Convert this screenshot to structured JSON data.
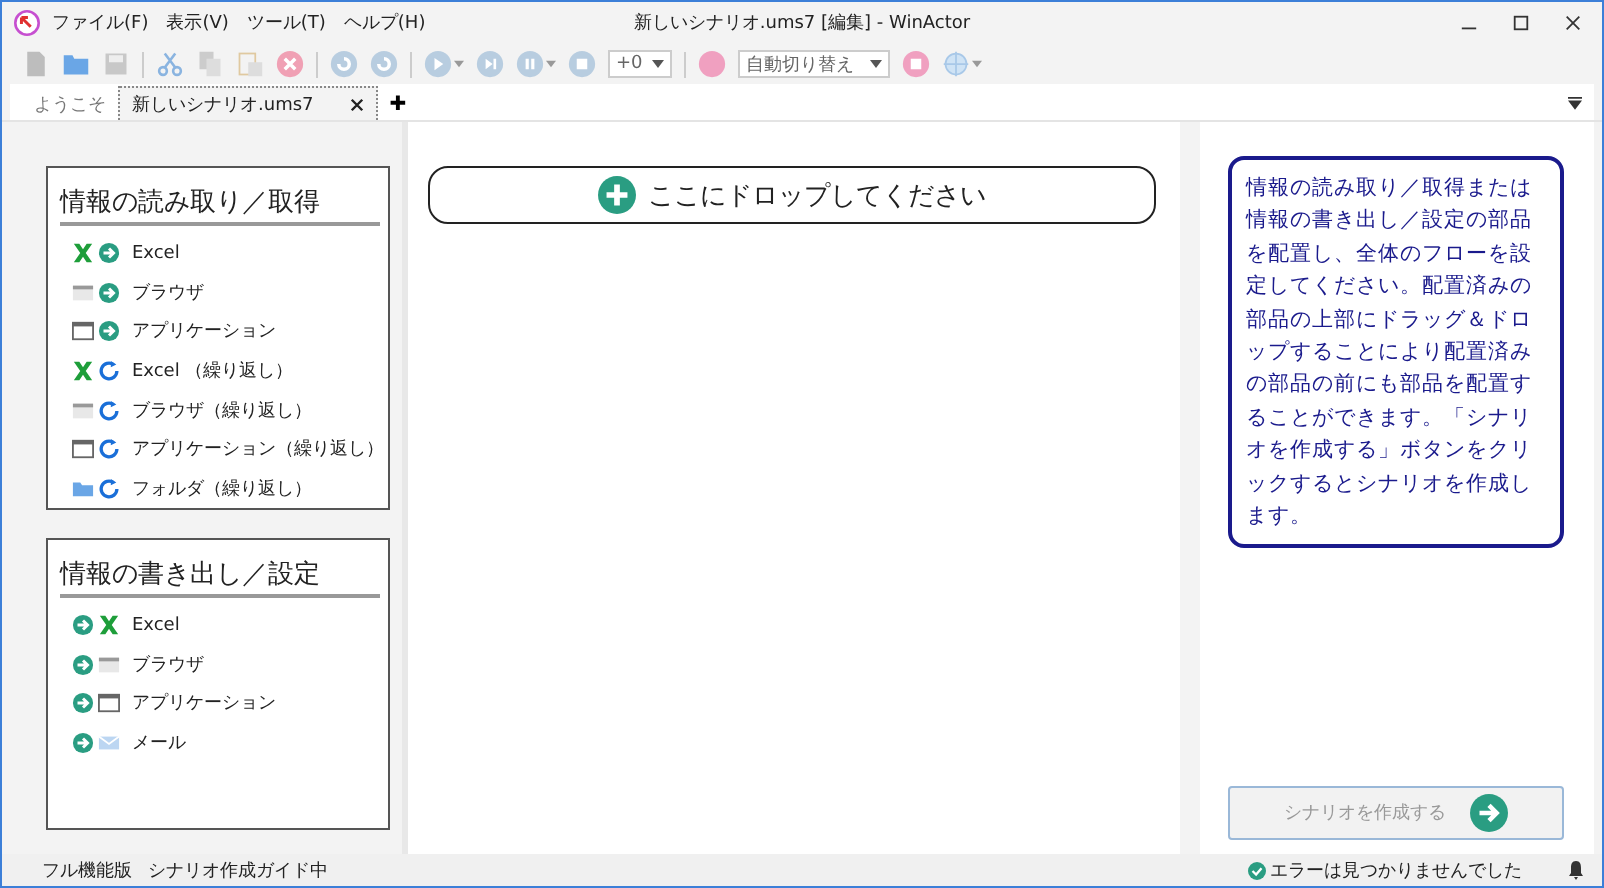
{
  "window": {
    "title": "新しいシナリオ.ums7 [編集] - WinActor"
  },
  "menu": [
    "ファイル(F)",
    "表示(V)",
    "ツール(T)",
    "ヘルプ(H)"
  ],
  "toolbar": {
    "combos": [
      "+0",
      "自動切り替え"
    ]
  },
  "tabs": [
    {
      "label": "ようこそ",
      "selected": false,
      "closable": false
    },
    {
      "label": "新しいシナリオ.ums7",
      "selected": true,
      "closable": true
    }
  ],
  "add_tab": "✚",
  "palette": [
    {
      "title": "情報の読み取り／取得",
      "kind": "read",
      "items": [
        {
          "label": "Excel",
          "kind": "excel",
          "loop": false
        },
        {
          "label": "ブラウザ",
          "kind": "browser",
          "loop": false
        },
        {
          "label": "アプリケーション",
          "kind": "app",
          "loop": false
        },
        {
          "label": "Excel （繰り返し）",
          "kind": "excel",
          "loop": true
        },
        {
          "label": "ブラウザ（繰り返し）",
          "kind": "browser",
          "loop": true
        },
        {
          "label": "アプリケーション（繰り返し）",
          "kind": "app",
          "loop": true
        },
        {
          "label": "フォルダ（繰り返し）",
          "kind": "folder",
          "loop": true
        }
      ]
    },
    {
      "title": "情報の書き出し／設定",
      "kind": "write",
      "items": [
        {
          "label": "Excel",
          "kind": "excel",
          "loop": false
        },
        {
          "label": "ブラウザ",
          "kind": "browser",
          "loop": false
        },
        {
          "label": "アプリケーション",
          "kind": "app",
          "loop": false
        },
        {
          "label": "メール",
          "kind": "mail",
          "loop": false
        }
      ]
    }
  ],
  "drop_zone": {
    "label": "ここにドロップしてください"
  },
  "guide": {
    "text": "情報の読み取り／取得または情報の書き出し／設定の部品を配置し、全体のフローを設定してください。配置済みの部品の上部にドラッグ＆ドロップすることにより配置済みの部品の前にも部品を配置することができます。「シナリオを作成する」ボタンをクリックするとシナリオを作成します。"
  },
  "create_button": {
    "label": "シナリオを作成する",
    "disabled": true
  },
  "status_bar": {
    "left": [
      "フル機能版",
      "シナリオ作成ガイド中"
    ],
    "message": "エラーは見つかりませんでした"
  }
}
